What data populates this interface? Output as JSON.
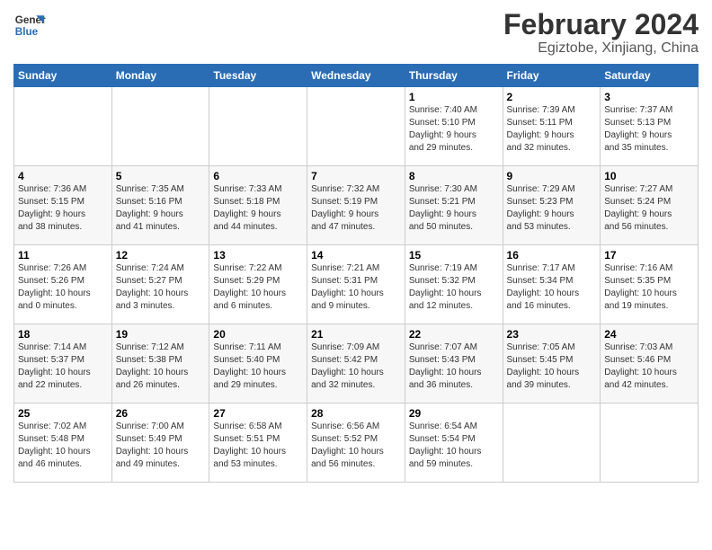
{
  "logo": {
    "line1": "General",
    "line2": "Blue"
  },
  "title": "February 2024",
  "subtitle": "Egiztobe, Xinjiang, China",
  "weekdays": [
    "Sunday",
    "Monday",
    "Tuesday",
    "Wednesday",
    "Thursday",
    "Friday",
    "Saturday"
  ],
  "weeks": [
    [
      {
        "num": "",
        "info": ""
      },
      {
        "num": "",
        "info": ""
      },
      {
        "num": "",
        "info": ""
      },
      {
        "num": "",
        "info": ""
      },
      {
        "num": "1",
        "info": "Sunrise: 7:40 AM\nSunset: 5:10 PM\nDaylight: 9 hours\nand 29 minutes."
      },
      {
        "num": "2",
        "info": "Sunrise: 7:39 AM\nSunset: 5:11 PM\nDaylight: 9 hours\nand 32 minutes."
      },
      {
        "num": "3",
        "info": "Sunrise: 7:37 AM\nSunset: 5:13 PM\nDaylight: 9 hours\nand 35 minutes."
      }
    ],
    [
      {
        "num": "4",
        "info": "Sunrise: 7:36 AM\nSunset: 5:15 PM\nDaylight: 9 hours\nand 38 minutes."
      },
      {
        "num": "5",
        "info": "Sunrise: 7:35 AM\nSunset: 5:16 PM\nDaylight: 9 hours\nand 41 minutes."
      },
      {
        "num": "6",
        "info": "Sunrise: 7:33 AM\nSunset: 5:18 PM\nDaylight: 9 hours\nand 44 minutes."
      },
      {
        "num": "7",
        "info": "Sunrise: 7:32 AM\nSunset: 5:19 PM\nDaylight: 9 hours\nand 47 minutes."
      },
      {
        "num": "8",
        "info": "Sunrise: 7:30 AM\nSunset: 5:21 PM\nDaylight: 9 hours\nand 50 minutes."
      },
      {
        "num": "9",
        "info": "Sunrise: 7:29 AM\nSunset: 5:23 PM\nDaylight: 9 hours\nand 53 minutes."
      },
      {
        "num": "10",
        "info": "Sunrise: 7:27 AM\nSunset: 5:24 PM\nDaylight: 9 hours\nand 56 minutes."
      }
    ],
    [
      {
        "num": "11",
        "info": "Sunrise: 7:26 AM\nSunset: 5:26 PM\nDaylight: 10 hours\nand 0 minutes."
      },
      {
        "num": "12",
        "info": "Sunrise: 7:24 AM\nSunset: 5:27 PM\nDaylight: 10 hours\nand 3 minutes."
      },
      {
        "num": "13",
        "info": "Sunrise: 7:22 AM\nSunset: 5:29 PM\nDaylight: 10 hours\nand 6 minutes."
      },
      {
        "num": "14",
        "info": "Sunrise: 7:21 AM\nSunset: 5:31 PM\nDaylight: 10 hours\nand 9 minutes."
      },
      {
        "num": "15",
        "info": "Sunrise: 7:19 AM\nSunset: 5:32 PM\nDaylight: 10 hours\nand 12 minutes."
      },
      {
        "num": "16",
        "info": "Sunrise: 7:17 AM\nSunset: 5:34 PM\nDaylight: 10 hours\nand 16 minutes."
      },
      {
        "num": "17",
        "info": "Sunrise: 7:16 AM\nSunset: 5:35 PM\nDaylight: 10 hours\nand 19 minutes."
      }
    ],
    [
      {
        "num": "18",
        "info": "Sunrise: 7:14 AM\nSunset: 5:37 PM\nDaylight: 10 hours\nand 22 minutes."
      },
      {
        "num": "19",
        "info": "Sunrise: 7:12 AM\nSunset: 5:38 PM\nDaylight: 10 hours\nand 26 minutes."
      },
      {
        "num": "20",
        "info": "Sunrise: 7:11 AM\nSunset: 5:40 PM\nDaylight: 10 hours\nand 29 minutes."
      },
      {
        "num": "21",
        "info": "Sunrise: 7:09 AM\nSunset: 5:42 PM\nDaylight: 10 hours\nand 32 minutes."
      },
      {
        "num": "22",
        "info": "Sunrise: 7:07 AM\nSunset: 5:43 PM\nDaylight: 10 hours\nand 36 minutes."
      },
      {
        "num": "23",
        "info": "Sunrise: 7:05 AM\nSunset: 5:45 PM\nDaylight: 10 hours\nand 39 minutes."
      },
      {
        "num": "24",
        "info": "Sunrise: 7:03 AM\nSunset: 5:46 PM\nDaylight: 10 hours\nand 42 minutes."
      }
    ],
    [
      {
        "num": "25",
        "info": "Sunrise: 7:02 AM\nSunset: 5:48 PM\nDaylight: 10 hours\nand 46 minutes."
      },
      {
        "num": "26",
        "info": "Sunrise: 7:00 AM\nSunset: 5:49 PM\nDaylight: 10 hours\nand 49 minutes."
      },
      {
        "num": "27",
        "info": "Sunrise: 6:58 AM\nSunset: 5:51 PM\nDaylight: 10 hours\nand 53 minutes."
      },
      {
        "num": "28",
        "info": "Sunrise: 6:56 AM\nSunset: 5:52 PM\nDaylight: 10 hours\nand 56 minutes."
      },
      {
        "num": "29",
        "info": "Sunrise: 6:54 AM\nSunset: 5:54 PM\nDaylight: 10 hours\nand 59 minutes."
      },
      {
        "num": "",
        "info": ""
      },
      {
        "num": "",
        "info": ""
      }
    ]
  ]
}
